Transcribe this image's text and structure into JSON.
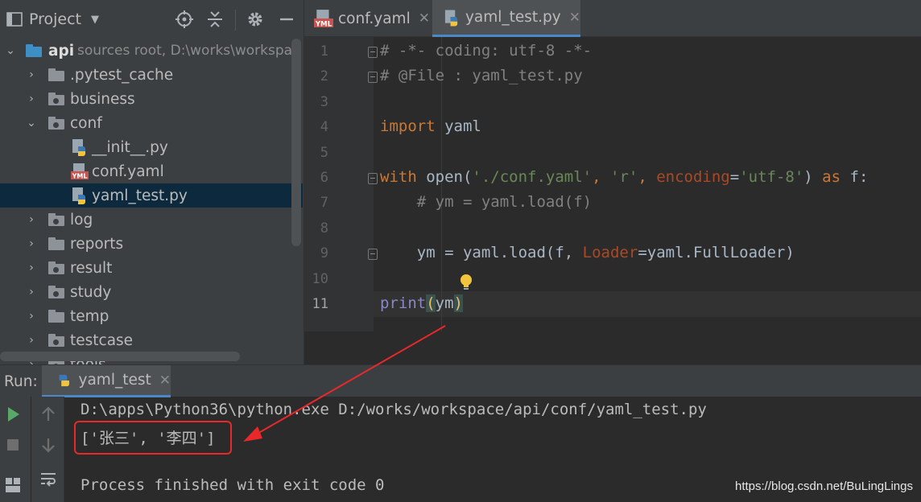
{
  "project_panel": {
    "title": "Project",
    "dropdown_icon": "caret-down-icon",
    "header_icons": [
      "locate-target-icon",
      "collapse-all-icon",
      "settings-gear-icon",
      "minimize-icon"
    ],
    "root": {
      "name": "api",
      "hint": "sources root,  D:\\works\\workspac"
    },
    "tree": [
      {
        "name": ".pytest_cache",
        "kind": "folder",
        "expanded": false
      },
      {
        "name": "business",
        "kind": "package",
        "expanded": false
      },
      {
        "name": "conf",
        "kind": "package",
        "expanded": true
      },
      {
        "name": "__init__.py",
        "kind": "python-file"
      },
      {
        "name": "conf.yaml",
        "kind": "yaml-file"
      },
      {
        "name": "yaml_test.py",
        "kind": "python-file",
        "selected": true
      },
      {
        "name": "log",
        "kind": "package",
        "expanded": false
      },
      {
        "name": "reports",
        "kind": "folder",
        "expanded": false
      },
      {
        "name": "result",
        "kind": "package",
        "expanded": false
      },
      {
        "name": "study",
        "kind": "package",
        "expanded": false
      },
      {
        "name": "temp",
        "kind": "folder",
        "expanded": false
      },
      {
        "name": "testcase",
        "kind": "package",
        "expanded": false
      },
      {
        "name": "tools",
        "kind": "package",
        "expanded": false
      }
    ]
  },
  "editor": {
    "tabs": [
      {
        "label": "conf.yaml",
        "close": "✕",
        "active": false
      },
      {
        "label": "yaml_test.py",
        "close": "✕",
        "active": true
      }
    ],
    "line_numbers": [
      "1",
      "2",
      "3",
      "4",
      "5",
      "6",
      "7",
      "8",
      "9",
      "10",
      "11"
    ],
    "current_line": "11",
    "lines": {
      "l1": "# -*- coding: utf-8 -*-",
      "l2": "# @File : yaml_test.py",
      "l4_kw": "import",
      "l4_rest": " yaml",
      "l6_kw": "with",
      "l6_a": " open(",
      "l6_s1": "'./conf.yaml'",
      "l6_b": ", ",
      "l6_s2": "'r'",
      "l6_c": ", ",
      "l6_p": "encoding",
      "l6_d": "=",
      "l6_s3": "'utf-8'",
      "l6_e": ") ",
      "l6_kw2": "as",
      "l6_f": " f:",
      "l7": "    # ym = yaml.load(f)",
      "l9_a": "    ym = yaml.load(f, ",
      "l9_p": "Loader",
      "l9_b": "=yaml.FullLoader)",
      "l11_fn": "print",
      "l11_o": "(",
      "l11_v": "ym",
      "l11_c": ")"
    }
  },
  "run_panel": {
    "label": "Run:",
    "tab_label": "yaml_test",
    "tab_close": "✕",
    "console": [
      "D:\\apps\\Python36\\python.exe D:/works/workspace/api/conf/yaml_test.py",
      "['张三', '李四']",
      "",
      "Process finished with exit code 0"
    ],
    "toolbar_icons": [
      "run-icon",
      "stop-icon",
      "up-arrow-icon",
      "down-arrow-icon",
      "soft-wrap-icon",
      "layout-icon"
    ]
  },
  "annotation": {
    "color": "#e8282b"
  },
  "watermark": "https://blog.csdn.net/BuLingLings"
}
